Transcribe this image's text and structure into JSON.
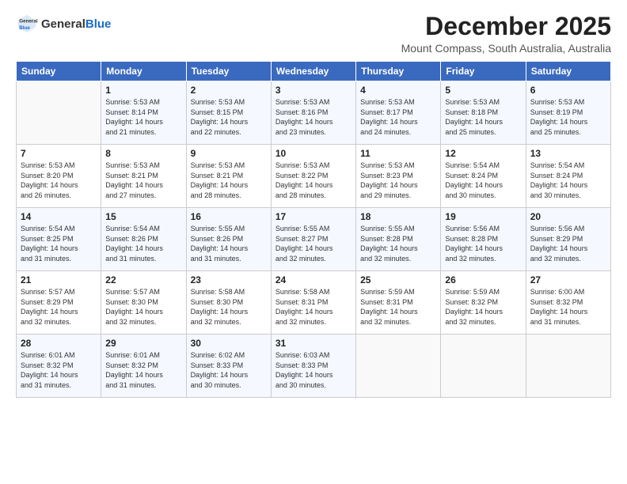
{
  "logo": {
    "general": "General",
    "blue": "Blue"
  },
  "header": {
    "month_year": "December 2025",
    "location": "Mount Compass, South Australia, Australia"
  },
  "days_of_week": [
    "Sunday",
    "Monday",
    "Tuesday",
    "Wednesday",
    "Thursday",
    "Friday",
    "Saturday"
  ],
  "weeks": [
    [
      {
        "day": "",
        "info": ""
      },
      {
        "day": "1",
        "info": "Sunrise: 5:53 AM\nSunset: 8:14 PM\nDaylight: 14 hours\nand 21 minutes."
      },
      {
        "day": "2",
        "info": "Sunrise: 5:53 AM\nSunset: 8:15 PM\nDaylight: 14 hours\nand 22 minutes."
      },
      {
        "day": "3",
        "info": "Sunrise: 5:53 AM\nSunset: 8:16 PM\nDaylight: 14 hours\nand 23 minutes."
      },
      {
        "day": "4",
        "info": "Sunrise: 5:53 AM\nSunset: 8:17 PM\nDaylight: 14 hours\nand 24 minutes."
      },
      {
        "day": "5",
        "info": "Sunrise: 5:53 AM\nSunset: 8:18 PM\nDaylight: 14 hours\nand 25 minutes."
      },
      {
        "day": "6",
        "info": "Sunrise: 5:53 AM\nSunset: 8:19 PM\nDaylight: 14 hours\nand 25 minutes."
      }
    ],
    [
      {
        "day": "7",
        "info": "Sunrise: 5:53 AM\nSunset: 8:20 PM\nDaylight: 14 hours\nand 26 minutes."
      },
      {
        "day": "8",
        "info": "Sunrise: 5:53 AM\nSunset: 8:21 PM\nDaylight: 14 hours\nand 27 minutes."
      },
      {
        "day": "9",
        "info": "Sunrise: 5:53 AM\nSunset: 8:21 PM\nDaylight: 14 hours\nand 28 minutes."
      },
      {
        "day": "10",
        "info": "Sunrise: 5:53 AM\nSunset: 8:22 PM\nDaylight: 14 hours\nand 28 minutes."
      },
      {
        "day": "11",
        "info": "Sunrise: 5:53 AM\nSunset: 8:23 PM\nDaylight: 14 hours\nand 29 minutes."
      },
      {
        "day": "12",
        "info": "Sunrise: 5:54 AM\nSunset: 8:24 PM\nDaylight: 14 hours\nand 30 minutes."
      },
      {
        "day": "13",
        "info": "Sunrise: 5:54 AM\nSunset: 8:24 PM\nDaylight: 14 hours\nand 30 minutes."
      }
    ],
    [
      {
        "day": "14",
        "info": "Sunrise: 5:54 AM\nSunset: 8:25 PM\nDaylight: 14 hours\nand 31 minutes."
      },
      {
        "day": "15",
        "info": "Sunrise: 5:54 AM\nSunset: 8:26 PM\nDaylight: 14 hours\nand 31 minutes."
      },
      {
        "day": "16",
        "info": "Sunrise: 5:55 AM\nSunset: 8:26 PM\nDaylight: 14 hours\nand 31 minutes."
      },
      {
        "day": "17",
        "info": "Sunrise: 5:55 AM\nSunset: 8:27 PM\nDaylight: 14 hours\nand 32 minutes."
      },
      {
        "day": "18",
        "info": "Sunrise: 5:55 AM\nSunset: 8:28 PM\nDaylight: 14 hours\nand 32 minutes."
      },
      {
        "day": "19",
        "info": "Sunrise: 5:56 AM\nSunset: 8:28 PM\nDaylight: 14 hours\nand 32 minutes."
      },
      {
        "day": "20",
        "info": "Sunrise: 5:56 AM\nSunset: 8:29 PM\nDaylight: 14 hours\nand 32 minutes."
      }
    ],
    [
      {
        "day": "21",
        "info": "Sunrise: 5:57 AM\nSunset: 8:29 PM\nDaylight: 14 hours\nand 32 minutes."
      },
      {
        "day": "22",
        "info": "Sunrise: 5:57 AM\nSunset: 8:30 PM\nDaylight: 14 hours\nand 32 minutes."
      },
      {
        "day": "23",
        "info": "Sunrise: 5:58 AM\nSunset: 8:30 PM\nDaylight: 14 hours\nand 32 minutes."
      },
      {
        "day": "24",
        "info": "Sunrise: 5:58 AM\nSunset: 8:31 PM\nDaylight: 14 hours\nand 32 minutes."
      },
      {
        "day": "25",
        "info": "Sunrise: 5:59 AM\nSunset: 8:31 PM\nDaylight: 14 hours\nand 32 minutes."
      },
      {
        "day": "26",
        "info": "Sunrise: 5:59 AM\nSunset: 8:32 PM\nDaylight: 14 hours\nand 32 minutes."
      },
      {
        "day": "27",
        "info": "Sunrise: 6:00 AM\nSunset: 8:32 PM\nDaylight: 14 hours\nand 31 minutes."
      }
    ],
    [
      {
        "day": "28",
        "info": "Sunrise: 6:01 AM\nSunset: 8:32 PM\nDaylight: 14 hours\nand 31 minutes."
      },
      {
        "day": "29",
        "info": "Sunrise: 6:01 AM\nSunset: 8:32 PM\nDaylight: 14 hours\nand 31 minutes."
      },
      {
        "day": "30",
        "info": "Sunrise: 6:02 AM\nSunset: 8:33 PM\nDaylight: 14 hours\nand 30 minutes."
      },
      {
        "day": "31",
        "info": "Sunrise: 6:03 AM\nSunset: 8:33 PM\nDaylight: 14 hours\nand 30 minutes."
      },
      {
        "day": "",
        "info": ""
      },
      {
        "day": "",
        "info": ""
      },
      {
        "day": "",
        "info": ""
      }
    ]
  ]
}
